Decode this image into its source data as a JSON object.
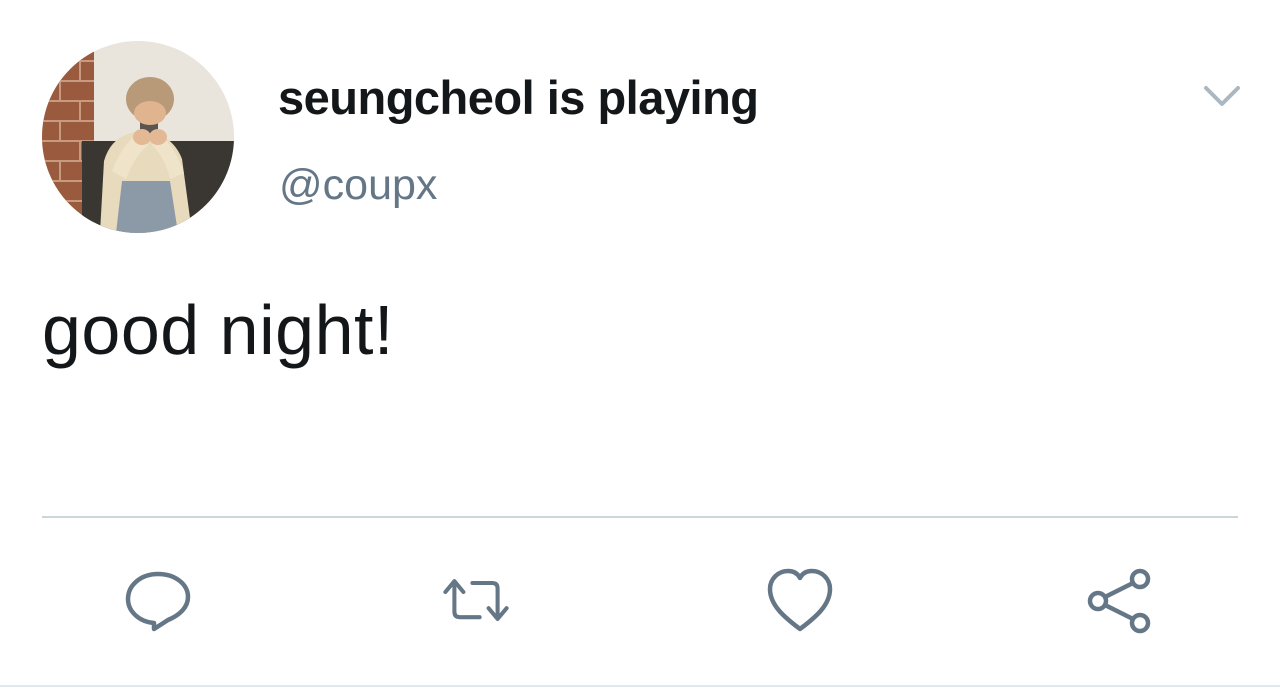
{
  "tweet": {
    "display_name": "seungcheol is playing",
    "handle": "@coupx",
    "text": "good night!"
  },
  "icons": {
    "menu": "chevron-down-icon",
    "reply": "speech-bubble-icon",
    "retweet": "retweet-arrows-icon",
    "like": "heart-icon",
    "share": "share-nodes-icon"
  },
  "colors": {
    "text_primary": "#14171a",
    "text_secondary": "#657786",
    "icon": "#657786",
    "divider": "#ccd6dd"
  }
}
